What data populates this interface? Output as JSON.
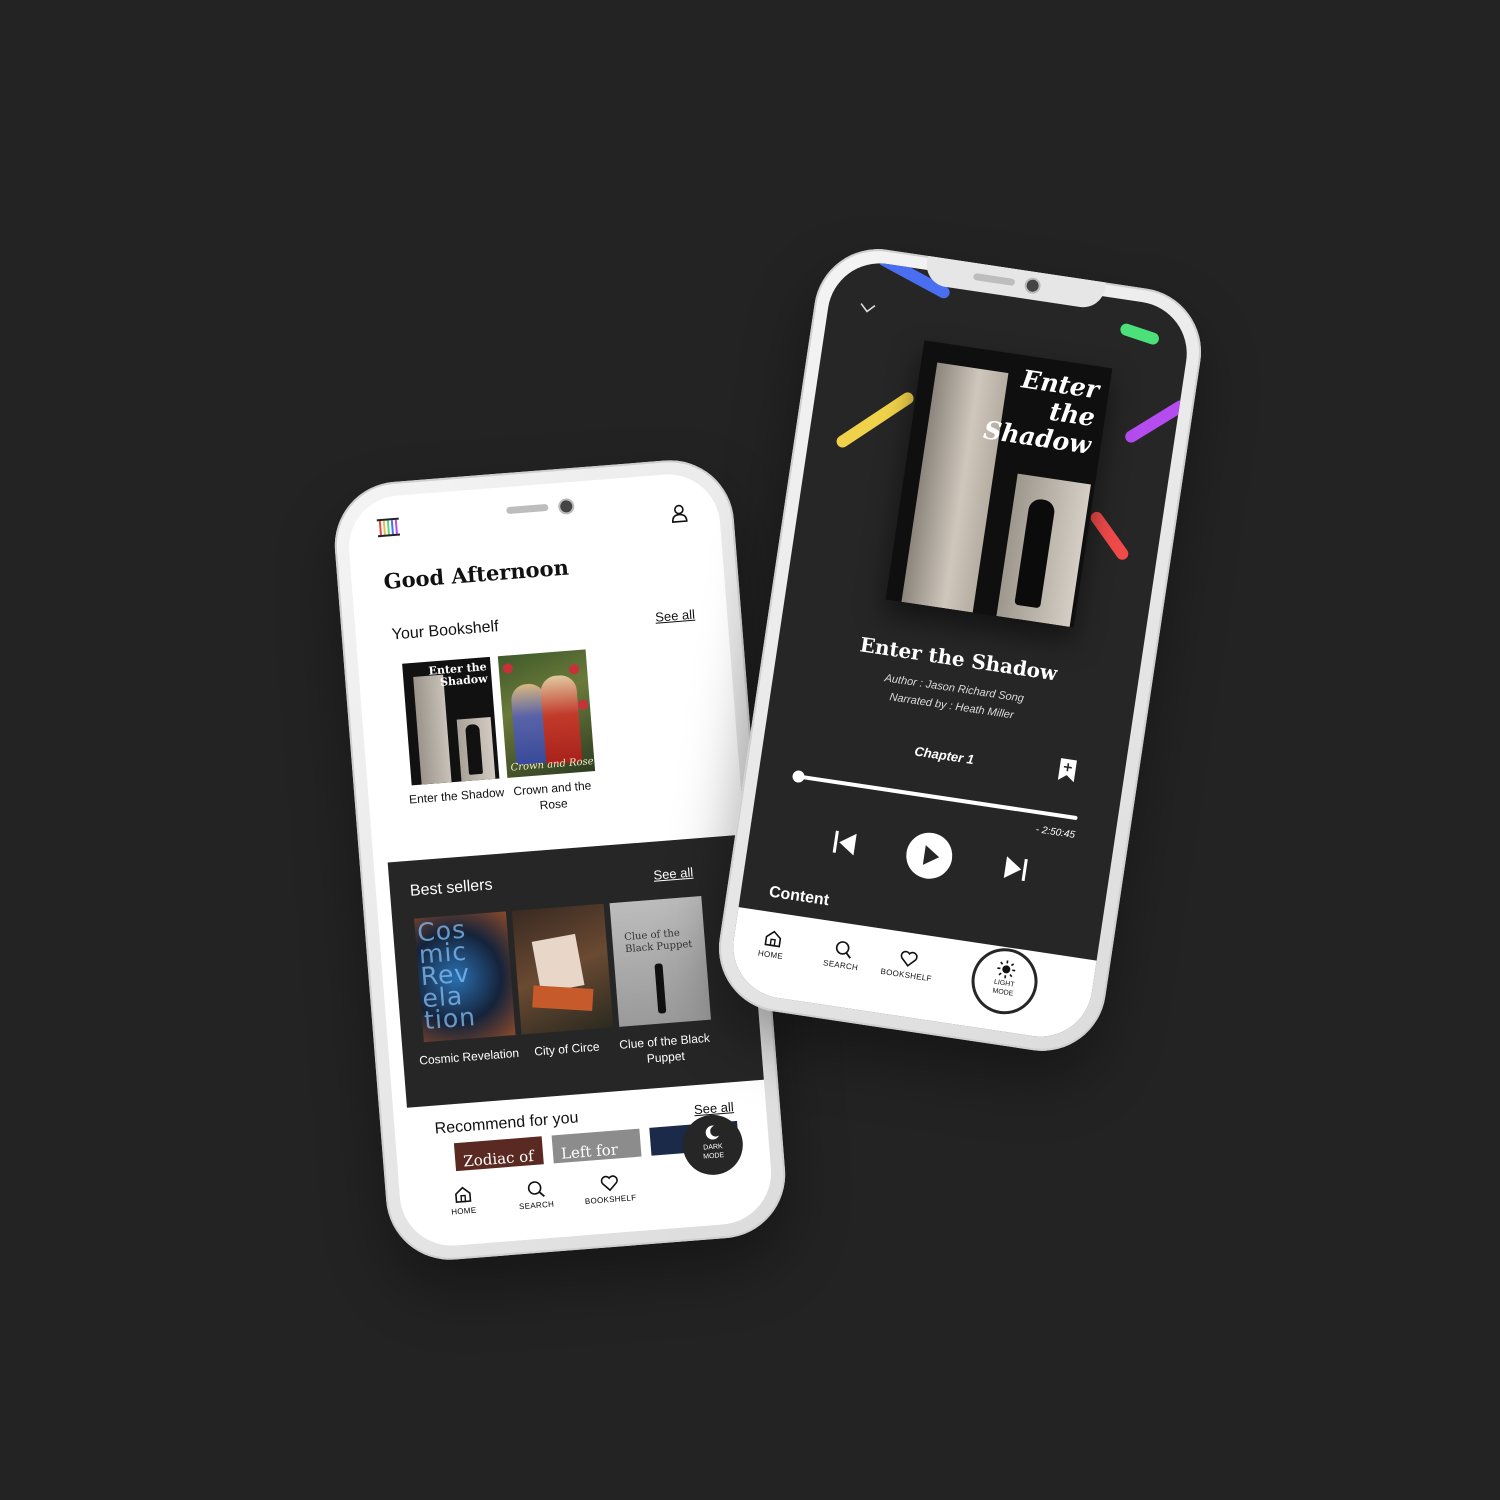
{
  "home": {
    "greeting": "Good Afternoon",
    "bookshelf": {
      "title": "Your Bookshelf",
      "see_all": "See all",
      "books": [
        {
          "label": "Enter the Shadow",
          "cover_text": "Enter the Shadow"
        },
        {
          "label": "Crown and the Rose",
          "cover_text": "Crown and Rose"
        }
      ]
    },
    "best_sellers": {
      "title": "Best sellers",
      "see_all": "See all",
      "books": [
        {
          "label": "Cosmic Revelation",
          "cover_text": "Cos mic Rev ela tion"
        },
        {
          "label": "City of Circe"
        },
        {
          "label": "Clue of the Black Puppet",
          "cover_text": "Clue of the Black Puppet"
        }
      ]
    },
    "recommend": {
      "title": "Recommend for you",
      "see_all": "See all",
      "covers": [
        {
          "text": "Zodiac of",
          "color": "#5a2a22"
        },
        {
          "text": "Left for",
          "color": "#8c8c8c"
        },
        {
          "text": "",
          "color": "#1c2a4a"
        }
      ]
    },
    "tabs": {
      "home": "HOME",
      "search": "SEARCH",
      "bookshelf": "BOOKSHELF"
    },
    "mode_button": {
      "line1": "DARK",
      "line2": "MODE"
    }
  },
  "player": {
    "cover_text": "Enter the Shadow",
    "title": "Enter the Shadow",
    "author": "Author : Jason Richard Song",
    "narrator": "Narrated by : Heath Miller",
    "chapter": "Chapter 1",
    "progress": 0.0,
    "remaining": "- 2:50:45",
    "content_label": "Content",
    "tabs": {
      "home": "HOME",
      "search": "SEARCH",
      "bookshelf": "BOOKSHELF"
    },
    "mode_button": {
      "line1": "LIGHT",
      "line2": "MODE"
    }
  },
  "colors": {
    "background": "#232323",
    "dark_panel": "#262626",
    "stripe_blue": "#4a6ef0",
    "stripe_green": "#4ce07a",
    "stripe_purple": "#b44cf0",
    "stripe_yellow": "#f0d24a",
    "stripe_red": "#f04a4a"
  },
  "icons": [
    "logo-icon",
    "profile-icon",
    "home-icon",
    "search-icon",
    "heart-icon",
    "moon-icon",
    "sun-icon",
    "chevron-down-icon",
    "bookmark-add-icon",
    "skip-back-icon",
    "play-icon",
    "skip-forward-icon"
  ]
}
